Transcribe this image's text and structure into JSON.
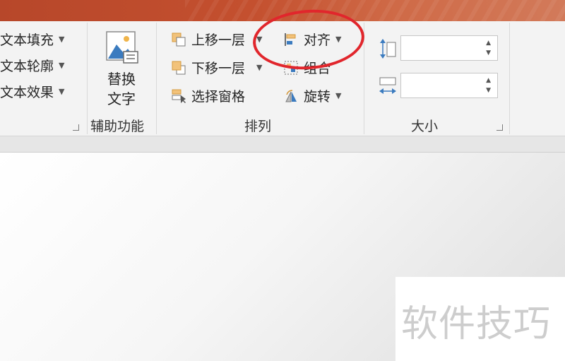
{
  "ribbon": {
    "text_group": {
      "fill_label": "文本填充",
      "outline_label": "文本轮廓",
      "effects_label": "文本效果"
    },
    "accessibility_group": {
      "alt_text_line1": "替换",
      "alt_text_line2": "文字",
      "label": "辅助功能"
    },
    "arrange_group": {
      "bring_forward_label": "上移一层",
      "send_backward_label": "下移一层",
      "selection_pane_label": "选择窗格",
      "align_label": "对齐",
      "group_label": "组合",
      "rotate_label": "旋转",
      "label": "排列"
    },
    "size_group": {
      "height_value": "",
      "width_value": "",
      "label": "大小"
    }
  },
  "annotation": {
    "circle_color": "#e1262c"
  },
  "watermark": {
    "text": "软件技巧"
  },
  "colors": {
    "titlebar": "#c4502f",
    "ribbon_bg": "#f3f3f3"
  }
}
